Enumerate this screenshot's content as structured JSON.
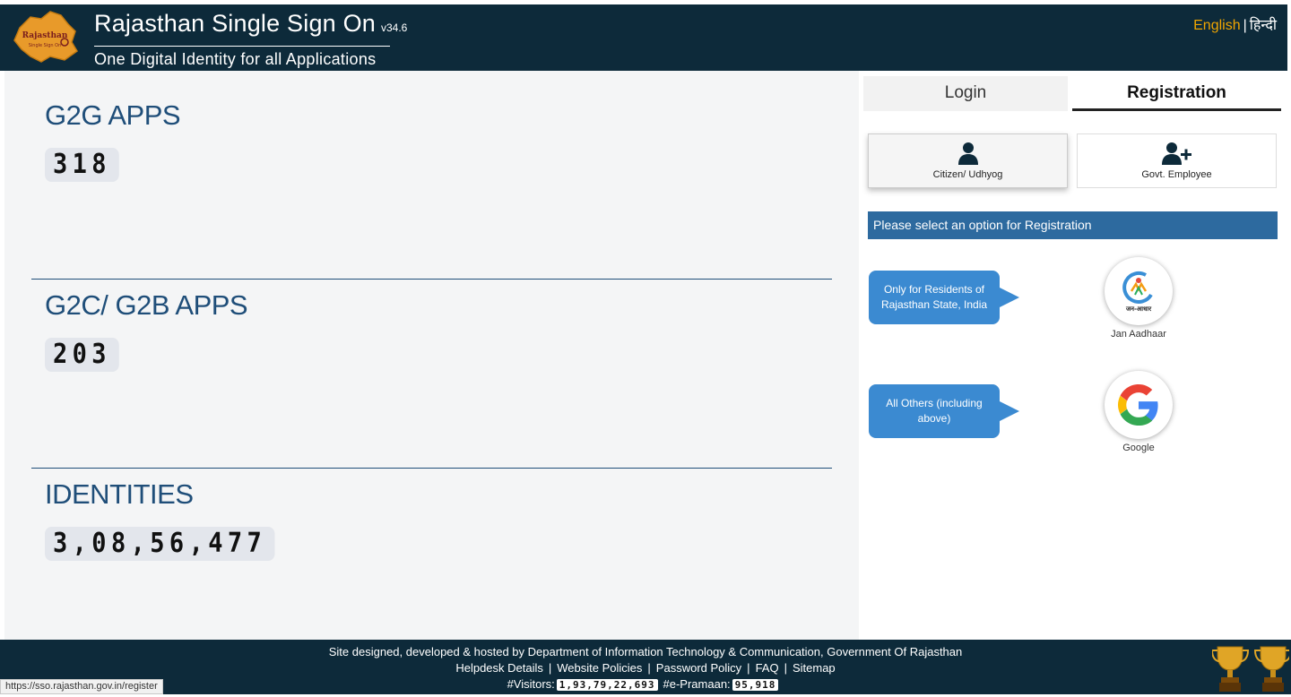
{
  "header": {
    "title": "Rajasthan Single Sign On",
    "version": "v34.6",
    "subtitle": "One Digital Identity for all Applications",
    "logo_text": "Rajasthan Single Sign On",
    "lang_english": "English",
    "lang_separator": "|",
    "lang_hindi": "हिन्दी"
  },
  "stats": [
    {
      "label": "G2G APPS",
      "value": "318"
    },
    {
      "label": "G2C/ G2B APPS",
      "value": "203"
    },
    {
      "label": "IDENTITIES",
      "value": "3,08,56,477"
    }
  ],
  "tabs": {
    "login": "Login",
    "registration": "Registration",
    "active": "registration"
  },
  "registration": {
    "options": [
      {
        "label": "Citizen/ Udhyog",
        "icon": "user-icon",
        "selected": true
      },
      {
        "label": "Govt. Employee",
        "icon": "user-plus-icon",
        "selected": false
      }
    ],
    "info": "Please select an option for Registration",
    "providers": [
      {
        "note": "Only for Residents of Rajasthan State, India",
        "label": "Jan Aadhaar",
        "logo_text": "जन-आधार"
      },
      {
        "note": "All Others (including above)",
        "label": "Google"
      }
    ]
  },
  "footer": {
    "credit": "Site designed, developed & hosted by Department of Information Technology & Communication, Government Of Rajasthan",
    "links": [
      "Helpdesk Details",
      "Website Policies",
      "Password Policy",
      "FAQ",
      "Sitemap"
    ],
    "visitors_label": "#Visitors:",
    "visitors_value": "1,93,79,22,693",
    "epramaan_label": "#e-Pramaan:",
    "epramaan_value": "95,918"
  },
  "status_bar_url": "https://sso.rajasthan.gov.in/register",
  "colors": {
    "header_bg": "#0d2a3a",
    "stat_title": "#1f4e79",
    "accent_english": "#f0a500",
    "info_bar": "#2d6a9f",
    "bubble": "#3b8ad1"
  }
}
